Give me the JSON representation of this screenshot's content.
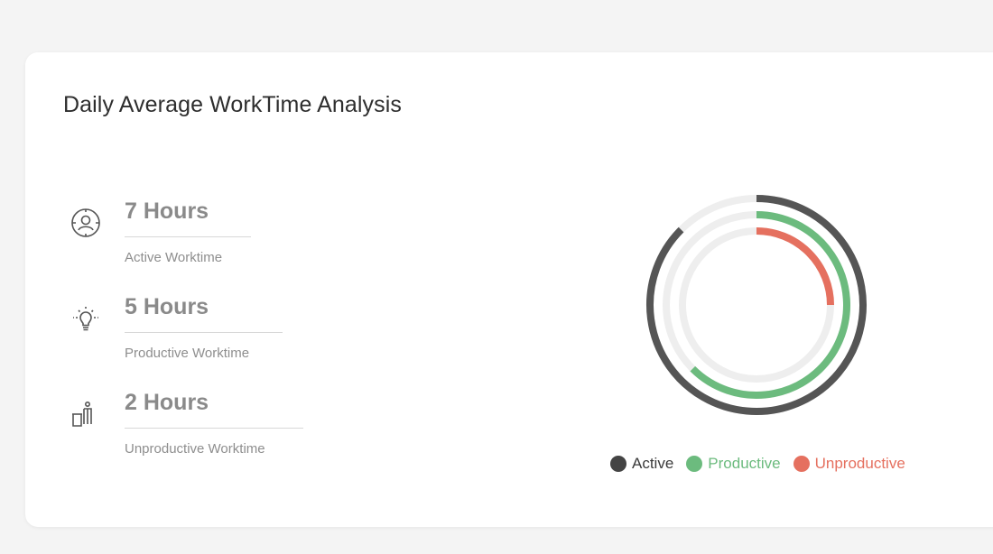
{
  "card": {
    "title": "Daily Average WorkTime Analysis"
  },
  "stats": [
    {
      "value": "7 Hours",
      "label": "Active Worktime",
      "icon": "user-circle-icon"
    },
    {
      "value": "5 Hours",
      "label": "Productive Worktime",
      "icon": "lightbulb-icon"
    },
    {
      "value": "2 Hours",
      "label": "Unproductive Worktime",
      "icon": "trash-bin-icon"
    }
  ],
  "chart_data": {
    "type": "radial-bar",
    "max": 8,
    "grid": false,
    "legend_position": "bottom",
    "series": [
      {
        "name": "Active",
        "value": 7,
        "color": "#555555"
      },
      {
        "name": "Productive",
        "value": 5,
        "color": "#6cbb7e"
      },
      {
        "name": "Unproductive",
        "value": 2,
        "color": "#e5705f"
      }
    ]
  },
  "colors": {
    "track": "#eeeeee",
    "active": "#555555",
    "productive": "#6cbb7e",
    "unproductive": "#e5705f",
    "active_text": "#3a3a3a"
  }
}
